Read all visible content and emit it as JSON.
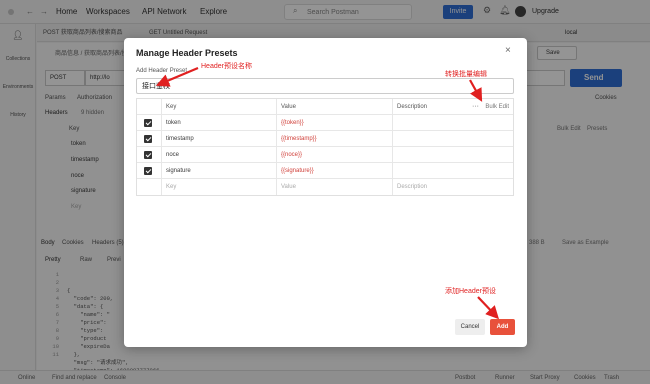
{
  "app": {
    "nav": [
      "Home",
      "Workspaces",
      "API Network",
      "Explore"
    ],
    "search_placeholder": "Search Postman",
    "invite_label": "Invite",
    "upgrade_label": "Upgrade",
    "env_label": "local"
  },
  "sidebar": [
    "Collections",
    "Environments",
    "History"
  ],
  "tabs": [
    "POST 获取商品列表/搜索商品",
    "GET Untitled Request"
  ],
  "request": {
    "breadcrumb": "商品信息 / 获取商品列表/搜",
    "method": "POST",
    "url": "http://lo",
    "send_label": "Send",
    "save_label": "Save",
    "subtabs": [
      "Params",
      "Authorization"
    ],
    "headers_label": "Headers",
    "hidden_label": "9 hidden",
    "cookies_label": "Cookies",
    "key_header": "Key",
    "bg_keys": [
      "token",
      "timestamp",
      "noce",
      "signature",
      "Key"
    ],
    "bulk_edit": "Bulk Edit",
    "presets": "Presets"
  },
  "response": {
    "tabs": [
      "Body",
      "Cookies",
      "Headers (5)"
    ],
    "size": "388 B",
    "save_example": "Save as Example",
    "view_tabs": [
      "Pretty",
      "Raw",
      "Previ"
    ],
    "code_lines": [
      "{",
      "  \"code\": 200,",
      "  \"data\": {",
      "    \"name\": \"",
      "    \"price\":",
      "    \"type\":",
      "    \"product",
      "    \"expireDa",
      "  },",
      "  \"msg\": \"请求成功\",",
      "  \"timestamp\": 1690087777966"
    ],
    "line_numbers": [
      "1",
      "2",
      "3",
      "4",
      "5",
      "6",
      "7",
      "8",
      "9",
      "10",
      "11"
    ]
  },
  "statusbar": {
    "left": [
      "Online",
      "Find and replace",
      "Console"
    ],
    "right": [
      "Postbot",
      "Runner",
      "Start Proxy",
      "Cookies",
      "Trash"
    ]
  },
  "modal": {
    "title": "Manage Header Presets",
    "close": "×",
    "preset_label": "Add Header Preset",
    "preset_value": "接口鉴权",
    "columns": [
      "Key",
      "Value",
      "Description"
    ],
    "more": "···",
    "bulk_edit": "Bulk Edit",
    "rows": [
      {
        "key": "token",
        "value": "{{token}}",
        "description": ""
      },
      {
        "key": "timestamp",
        "value": "{{timestamp}}",
        "description": ""
      },
      {
        "key": "noce",
        "value": "{{noce}}",
        "description": ""
      },
      {
        "key": "signature",
        "value": "{{signature}}",
        "description": ""
      }
    ],
    "placeholder_row": {
      "key": "Key",
      "value": "Value",
      "description": "Description"
    },
    "cancel_label": "Cancel",
    "add_label": "Add"
  },
  "annotations": {
    "preset_name": "Header预设名称",
    "bulk_edit": "转换批量编辑",
    "add_preset": "添加Header预设"
  },
  "colors": {
    "accent": "#e8513b",
    "send": "#2f6fd6",
    "annotation": "#e02020"
  }
}
